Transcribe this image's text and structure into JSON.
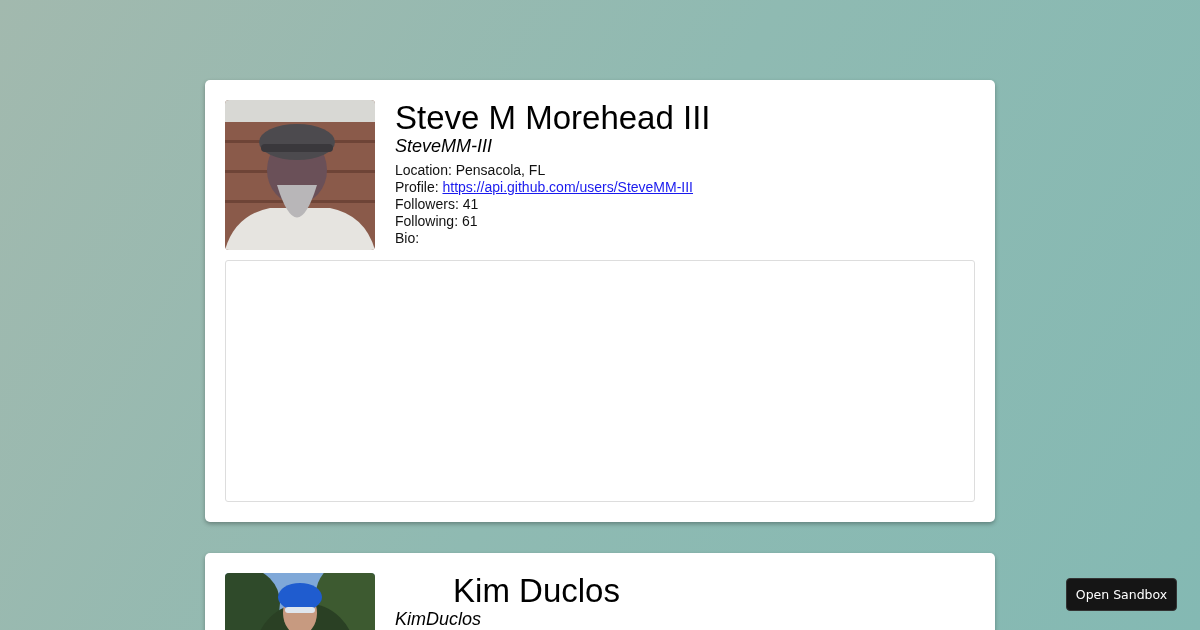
{
  "cards": [
    {
      "name": "Steve M Morehead III",
      "login": "SteveMM-III",
      "details": [
        {
          "kind": "text",
          "label": "Location:",
          "value": "Pensacola, FL"
        },
        {
          "kind": "link",
          "label": "Profile:",
          "value": "https://api.github.com/users/SteveMM-III"
        },
        {
          "kind": "text",
          "label": "Followers:",
          "value": "41"
        },
        {
          "kind": "text",
          "label": "Following:",
          "value": "61"
        },
        {
          "kind": "text",
          "label": "Bio:"
        }
      ]
    },
    {
      "name": "Kim Duclos",
      "login": "KimDuclos"
    }
  ],
  "sandbox_button": {
    "label": "Open Sandbox"
  }
}
